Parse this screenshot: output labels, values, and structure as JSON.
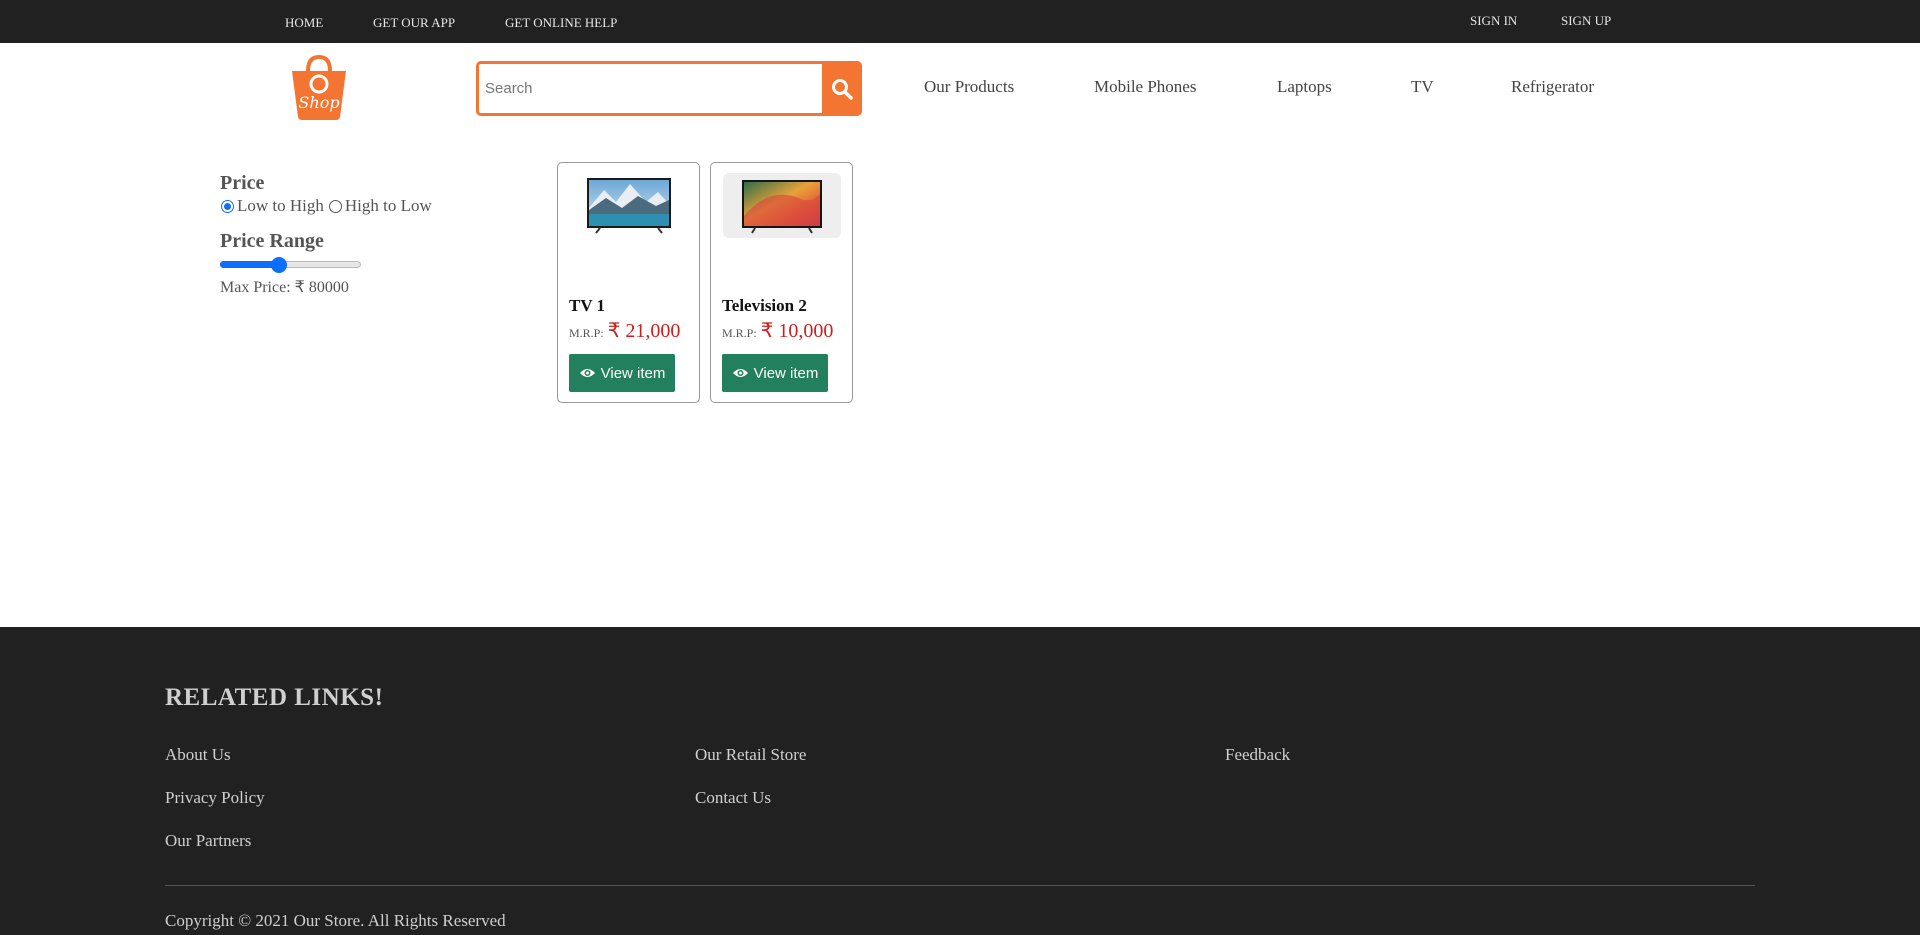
{
  "topbar": {
    "left_links": [
      "HOME",
      "GET OUR APP",
      "GET ONLINE HELP"
    ],
    "right_links": [
      "SIGN IN",
      "SIGN UP"
    ]
  },
  "header": {
    "logo_icon": "shopping-bag-logo",
    "search": {
      "placeholder": "Search",
      "value": ""
    },
    "search_icon": "search-icon",
    "nav": [
      "Our Products",
      "Mobile Phones",
      "Laptops",
      "TV",
      "Refrigerator"
    ]
  },
  "filters": {
    "price_title": "Price",
    "sort_options": [
      {
        "label": "Low to High",
        "checked": true
      },
      {
        "label": "High to Low",
        "checked": false
      }
    ],
    "range_title": "Price Range",
    "range_value_fraction": 0.42,
    "max_price_label": "Max Price: ₹ 80000"
  },
  "products": [
    {
      "name": "TV 1",
      "mrp_label": "M.R.P:",
      "price": "₹ 21,000",
      "button": "View item"
    },
    {
      "name": "Television 2",
      "mrp_label": "M.R.P:",
      "price": "₹ 10,000",
      "button": "View item"
    }
  ],
  "footer": {
    "heading": "RELATED LINKS!",
    "links": [
      "About Us",
      "Our Retail Store",
      "Feedback",
      "Privacy Policy",
      "Contact Us",
      "Our Partners"
    ],
    "copyright": "Copyright © 2021 Our Store. All Rights Reserved"
  },
  "colors": {
    "accent": "#f47432",
    "dark": "#212121",
    "button_green": "#23805f",
    "price_red": "#cc1f1f",
    "slider_blue": "#0d6efd"
  }
}
